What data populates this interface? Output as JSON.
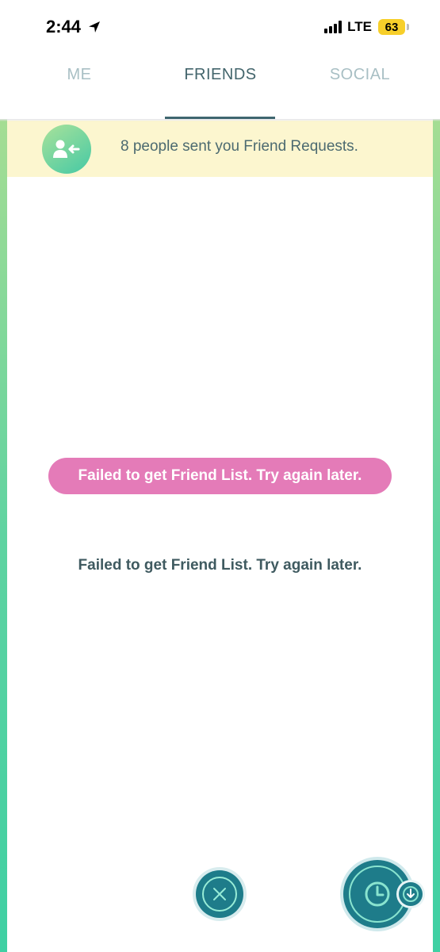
{
  "status_bar": {
    "time": "2:44",
    "location_icon": "location-arrow-icon",
    "network": "LTE",
    "battery": "63"
  },
  "tabs": [
    {
      "label": "ME",
      "active": false
    },
    {
      "label": "FRIENDS",
      "active": true
    },
    {
      "label": "SOCIAL",
      "active": false
    }
  ],
  "banner": {
    "icon": "friend-request-icon",
    "text": "8 people sent you Friend Requests."
  },
  "toast": {
    "text": "Failed to get Friend List. Try again later."
  },
  "empty_state": {
    "text": "Failed to get Friend List. Try again later."
  },
  "buttons": {
    "close_icon": "close-icon",
    "recent_icon": "clock-icon",
    "recent_badge_icon": "arrow-down-icon"
  },
  "colors": {
    "active_tab": "#43656c",
    "inactive_tab": "#a8bfc4",
    "banner_bg": "#fcf6cf",
    "toast_bg": "#e47bb8",
    "button_teal": "#1e7c8a",
    "side_green": "#5fd3a1",
    "battery_yellow": "#f7cf2a"
  }
}
